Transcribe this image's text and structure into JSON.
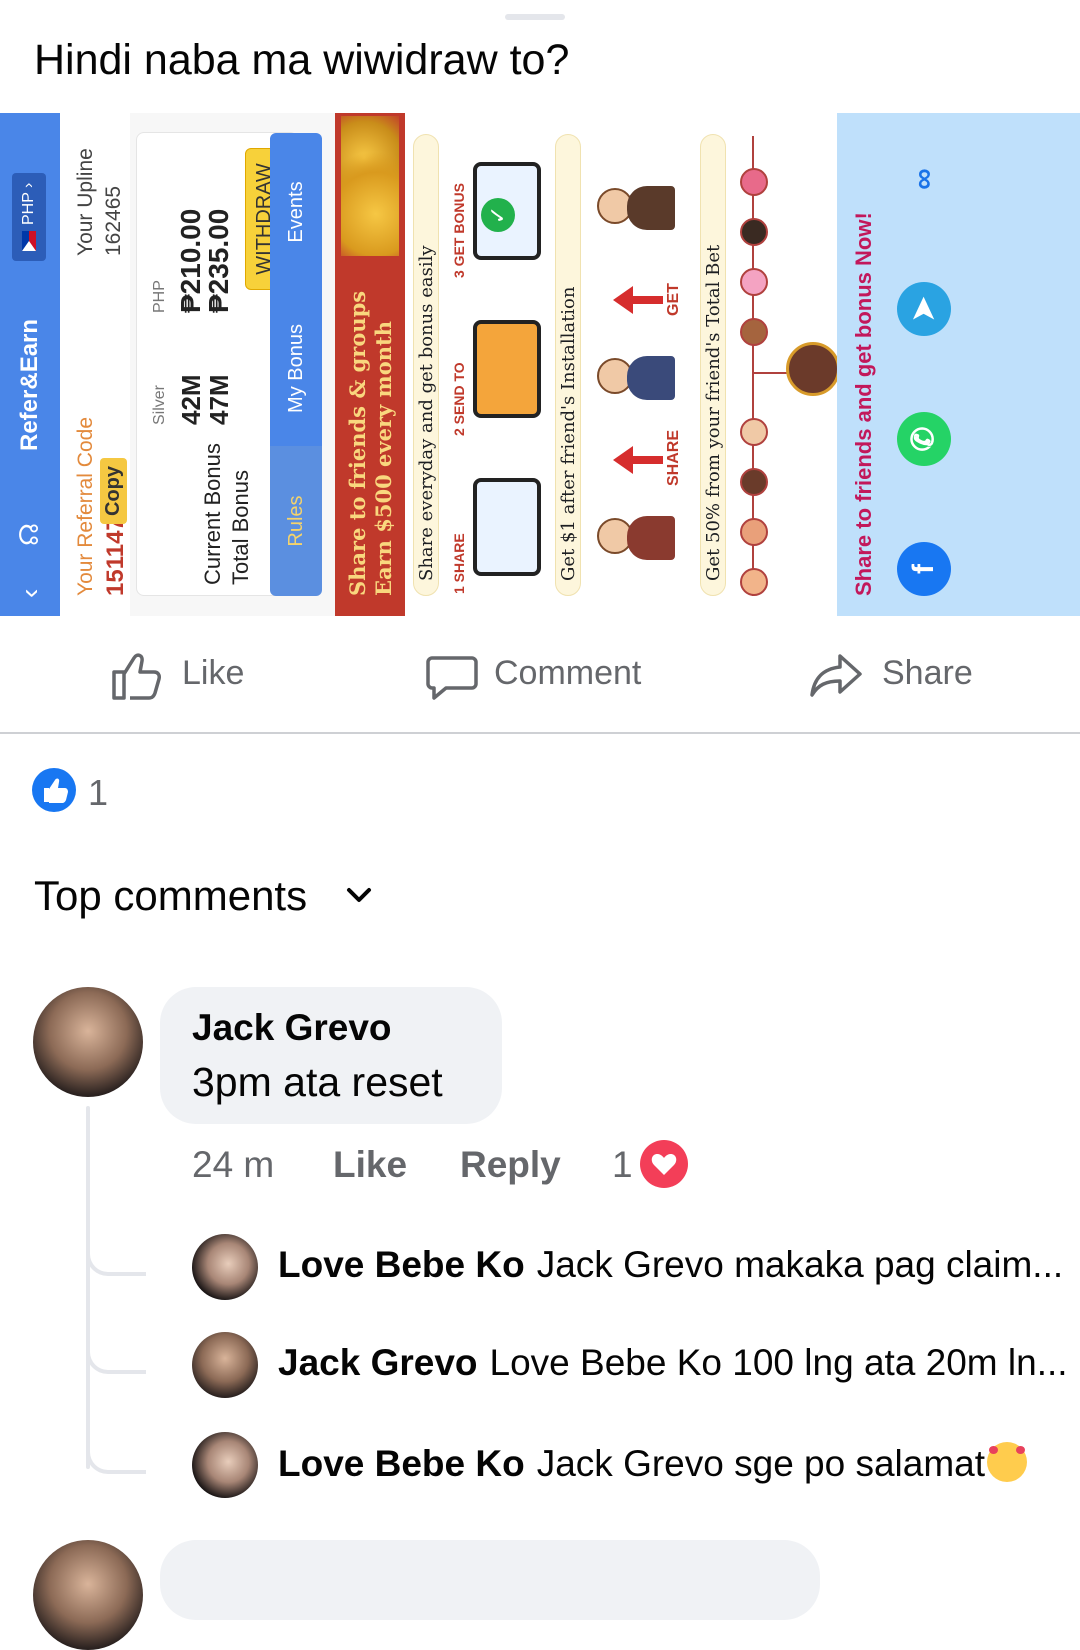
{
  "post": {
    "text": "Hindi naba ma wiwidraw to?"
  },
  "screenshot": {
    "nav": {
      "title": "Refer&Earn",
      "currency": "PHP"
    },
    "referral": {
      "label": "Your Referral Code",
      "code": "151147",
      "copy_label": "Copy"
    },
    "upline": {
      "label": "Your Upline",
      "value": "162465"
    },
    "bonus": {
      "current_label": "Current Bonus",
      "total_label": "Total Bonus",
      "silver_label": "Silver",
      "silver_current": "42M",
      "silver_total": "47M",
      "php_label": "PHP",
      "php_current": "₱210.00",
      "php_total": "₱235.00",
      "withdraw_label": "WITHDRAW"
    },
    "tabs": [
      "Rules",
      "My Bonus",
      "Events"
    ],
    "promo": {
      "line1": "Share to friends & groups",
      "line2": "Earn $500 every month"
    },
    "steps_title": "Share everyday and get bonus easily",
    "steps": [
      "1 SHARE",
      "2 SEND TO",
      "3 GET BONUS"
    ],
    "install_title": "Get $1 after friend's Installation",
    "arrow_labels": [
      "SHARE",
      "GET"
    ],
    "bet_title": "Get 50% from your friend's Total Bet",
    "share_title": "Share to friends and get bonus Now!",
    "share_icons": [
      "facebook-icon",
      "whatsapp-icon",
      "telegram-icon",
      "link-icon"
    ],
    "colors": {
      "nav_blue": "#4a86e8",
      "promo_red": "#c0392b",
      "share_blue": "#bfe0fb",
      "withdraw_yellow": "#f7d13a"
    }
  },
  "actions": {
    "like": "Like",
    "comment": "Comment",
    "share": "Share"
  },
  "reactions": {
    "count": "1"
  },
  "comments_header": "Top comments",
  "comment": {
    "author": "Jack Grevo",
    "text": "3pm ata reset",
    "time": "24 m",
    "like_label": "Like",
    "reply_label": "Reply",
    "reaction_count": "1"
  },
  "replies": [
    {
      "author": "Love Bebe Ko",
      "text": "Jack Grevo makaka pag claim..."
    },
    {
      "author": "Jack Grevo",
      "text": "Love Bebe Ko 100 lng ata 20m ln..."
    },
    {
      "author": "Love Bebe Ko",
      "text": "Jack Grevo sge po salamat"
    }
  ],
  "colors": {
    "facebook_blue": "#1877f2",
    "heart_red": "#f33e58",
    "muted_gray": "#65676b"
  }
}
